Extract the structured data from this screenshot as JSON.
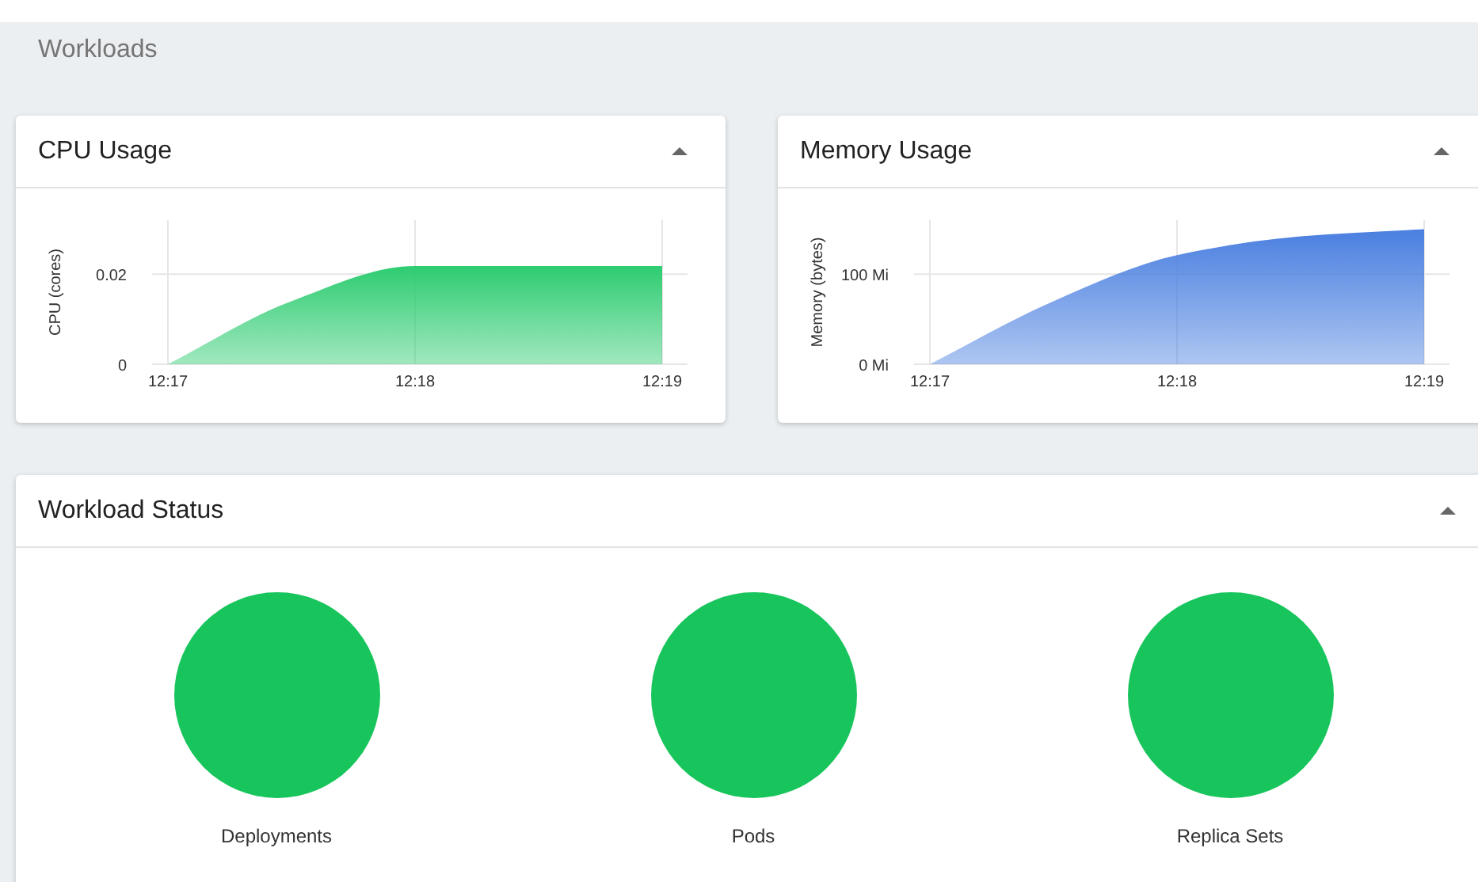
{
  "page": {
    "title": "Workloads"
  },
  "usage_cards": [
    {
      "title": "CPU Usage",
      "expanded": true,
      "chart_data": {
        "type": "area",
        "ylabel": "CPU (cores)",
        "grid": true,
        "categories": [
          "12:17",
          null,
          "12:18",
          null,
          "12:19"
        ],
        "yticks": [
          {
            "value": 0,
            "label": "0"
          },
          {
            "value": 0.02,
            "label": "0.02"
          }
        ],
        "ylim": [
          0,
          0.032
        ],
        "series": [
          {
            "color": "#2ecc71",
            "values": [
              0,
              0.014,
              0.0218,
              0.0218,
              0.0218
            ]
          }
        ]
      }
    },
    {
      "title": "Memory Usage",
      "expanded": true,
      "chart_data": {
        "type": "area",
        "ylabel": "Memory (bytes)",
        "grid": true,
        "categories": [
          "12:17",
          null,
          "12:18",
          null,
          "12:19"
        ],
        "yticks": [
          {
            "value": 0,
            "label": "0 Mi"
          },
          {
            "value": 100,
            "label": "100 Mi"
          }
        ],
        "ylim": [
          0,
          160
        ],
        "series": [
          {
            "color": "#4a7fe0",
            "values": [
              0,
              70,
              121,
              142,
              150
            ]
          }
        ]
      }
    }
  ],
  "workload_status": {
    "title": "Workload Status",
    "expanded": true,
    "items": [
      {
        "label": "Deployments"
      },
      {
        "label": "Pods"
      },
      {
        "label": "Replica Sets"
      }
    ]
  }
}
